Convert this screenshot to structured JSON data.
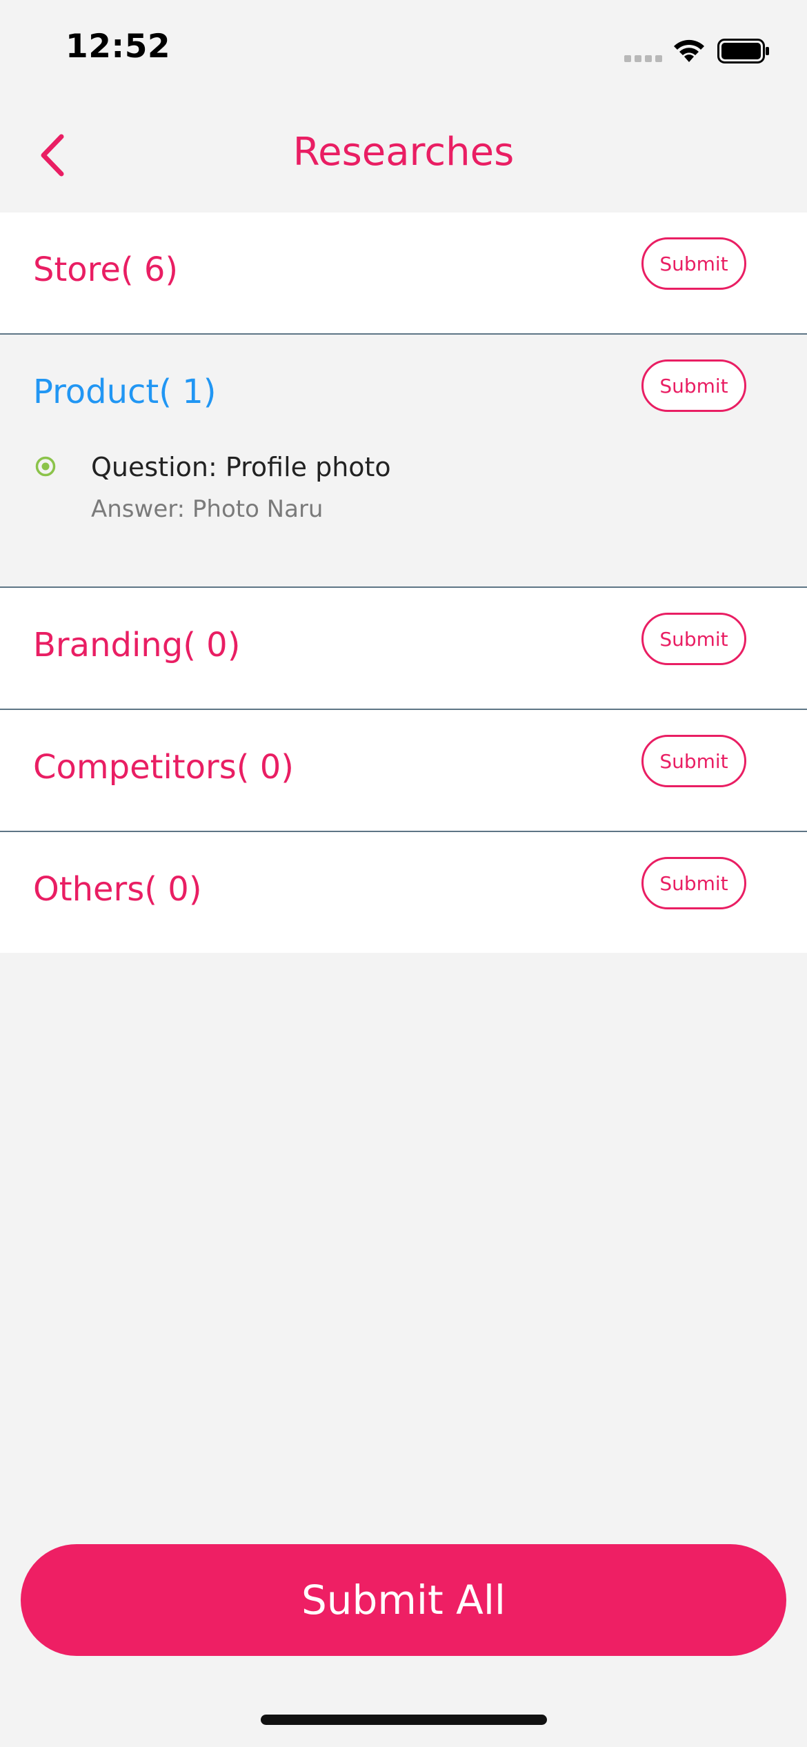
{
  "status_bar": {
    "time": "12:52"
  },
  "nav": {
    "title": "Researches",
    "back_icon": "chevron-left-icon"
  },
  "sections": [
    {
      "title": "Store( 6)",
      "submit_label": "Submit",
      "active": false
    },
    {
      "title": "Product( 1)",
      "submit_label": "Submit",
      "active": true,
      "items": [
        {
          "question": "Question: Profile photo",
          "answer": "Answer: Photo Naru"
        }
      ]
    },
    {
      "title": "Branding( 0)",
      "submit_label": "Submit",
      "active": false
    },
    {
      "title": "Competitors( 0)",
      "submit_label": "Submit",
      "active": false
    },
    {
      "title": "Others( 0)",
      "submit_label": "Submit",
      "active": false
    }
  ],
  "footer": {
    "submit_all_label": "Submit All"
  },
  "colors": {
    "accent": "#e91e63",
    "active": "#2196f3",
    "radio": "#8bc34a",
    "background": "#f3f3f3",
    "divider": "#5d7585"
  }
}
